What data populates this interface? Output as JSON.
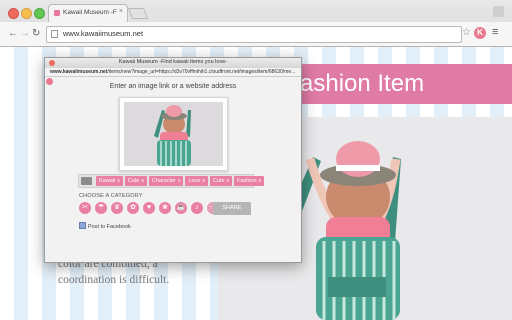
{
  "browser": {
    "tab_title": "Kawaii Museum -Find kaw",
    "tab_close": "×",
    "url": "www.kawaiimuseum.net",
    "back": "←",
    "forward": "→",
    "reload": "↻",
    "star": "☆",
    "extension_letter": "K",
    "menu": "≡"
  },
  "site": {
    "title": "ashion Item",
    "text": "color are combined, a coordination is difficult."
  },
  "popup": {
    "title": "Kawaii Museum -Find kawaii items you love-",
    "url_host": "www.kawaiimuseum.net",
    "url_rest": "/items/new?image_url=https://d3v70vffmihih1.cloudfront.net/images/item/68630/me...",
    "prompt": "Enter an image link or a website address",
    "tags": [
      "Kawaii",
      "Cute",
      "Character",
      "Love",
      "Cute",
      "Fashion"
    ],
    "tag_remove": "x",
    "category_label": "CHOOSE A CATEGORY",
    "categories": [
      "✂",
      "☂",
      "♛",
      "✿",
      "♥",
      "❀",
      "☕",
      "♪",
      "⋯"
    ],
    "share_label": "SHARE",
    "facebook_label": "Post to Facebook"
  },
  "colors": {
    "pink": "#ea7fa5",
    "banner_pink": "#e07ba6",
    "stripe_blue": "#e2eef8"
  }
}
